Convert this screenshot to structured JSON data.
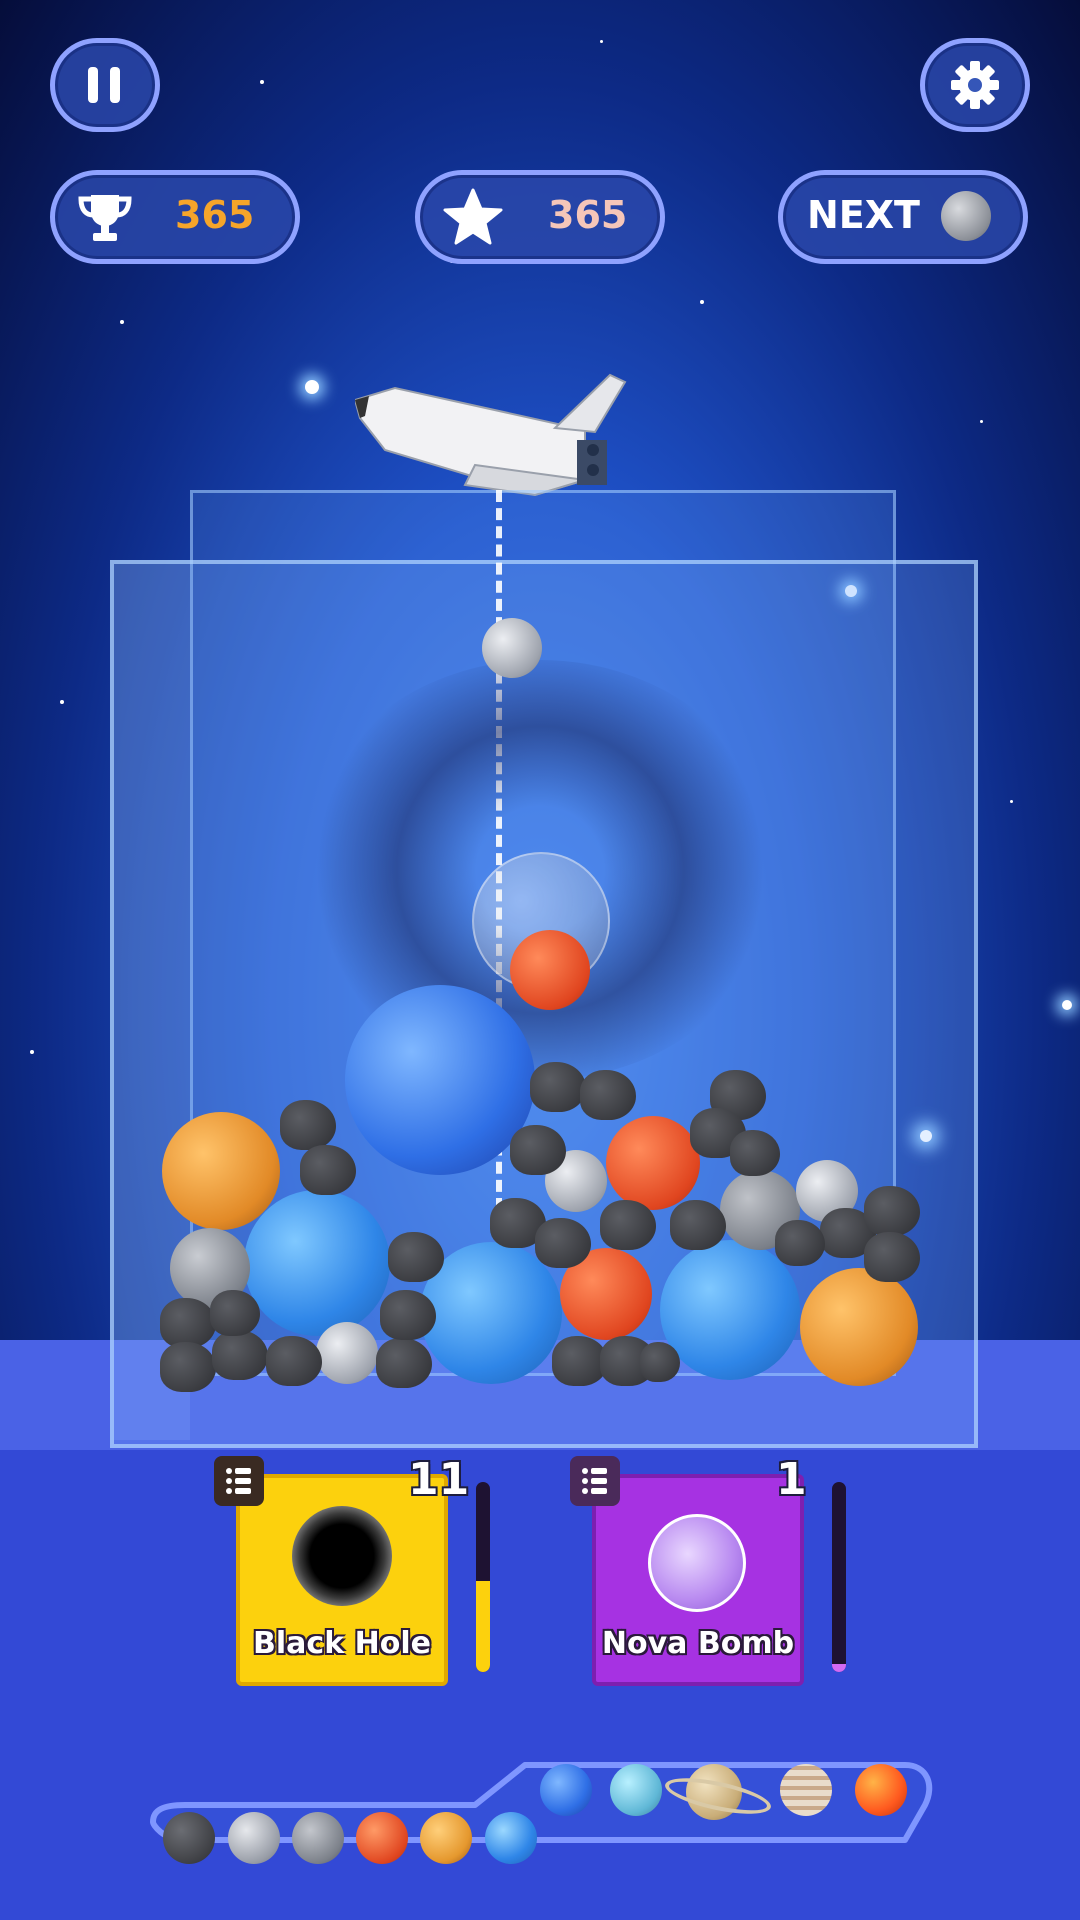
{
  "hud": {
    "trophy_score": "365",
    "star_score": "365",
    "next_label": "NEXT",
    "next_item_icon": "moon-ball-icon"
  },
  "powerups": [
    {
      "label": "Black Hole",
      "count": "11",
      "meter_level": 0.48,
      "color": "#fcd10d",
      "icon": "black-hole-icon"
    },
    {
      "label": "Nova Bomb",
      "count": "1",
      "meter_level": 0.04,
      "color": "#a632e2",
      "icon": "nova-bomb-icon"
    }
  ],
  "evolution_chain": [
    "asteroid-icon",
    "moon-icon",
    "gray-planet-icon",
    "mars-icon",
    "venus-icon",
    "earth-icon",
    "neptune-icon",
    "uranus-icon",
    "saturn-icon",
    "jupiter-icon",
    "sun-icon"
  ],
  "colors": {
    "trophy_score": "#f6a52a",
    "star_score": "#f5c6b9",
    "accent_border": "#8fa2ff"
  }
}
